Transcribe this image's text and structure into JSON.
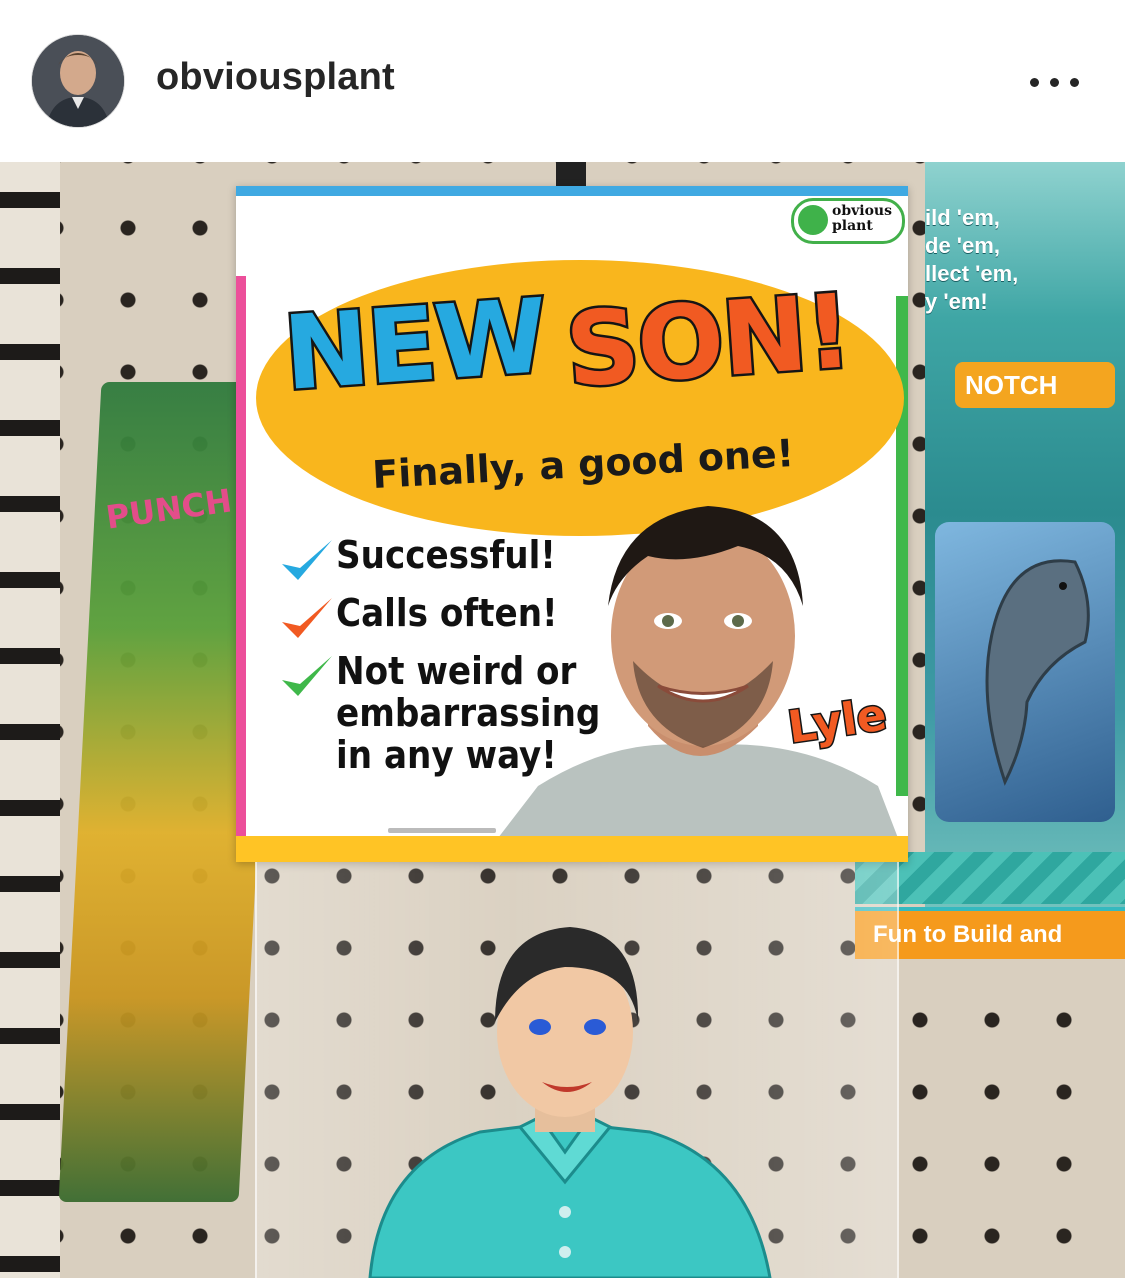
{
  "header": {
    "username": "obviousplant",
    "avatar_icon": "avatar-icon",
    "more_icon": "more-horizontal-icon"
  },
  "photo": {
    "card": {
      "title_word_1": "NEW",
      "title_word_2": "SON!",
      "tagline": "Finally, a good one!",
      "logo_text_line_1": "obvious",
      "logo_text_line_2": "plant",
      "checklist": [
        {
          "label": "Successful!",
          "color": "#26a9e0"
        },
        {
          "label": "Calls often!",
          "color": "#f15a22"
        },
        {
          "label": "Not weird or embarrassing in any way!",
          "color": "#3fb84a"
        }
      ],
      "name": "Lyle"
    },
    "background_packages": {
      "right_text": "ild 'em,\nde 'em,\nllect 'em,\ny 'em!",
      "right_label": "NOTCH",
      "right_banner": "Fun to Build and",
      "left_text": "PUNCH CRITT"
    }
  },
  "colors": {
    "blue": "#26a9e0",
    "orange": "#f15a22",
    "yellow": "#f9b61d",
    "green": "#3fb84a",
    "pink": "#ec4f9a"
  }
}
